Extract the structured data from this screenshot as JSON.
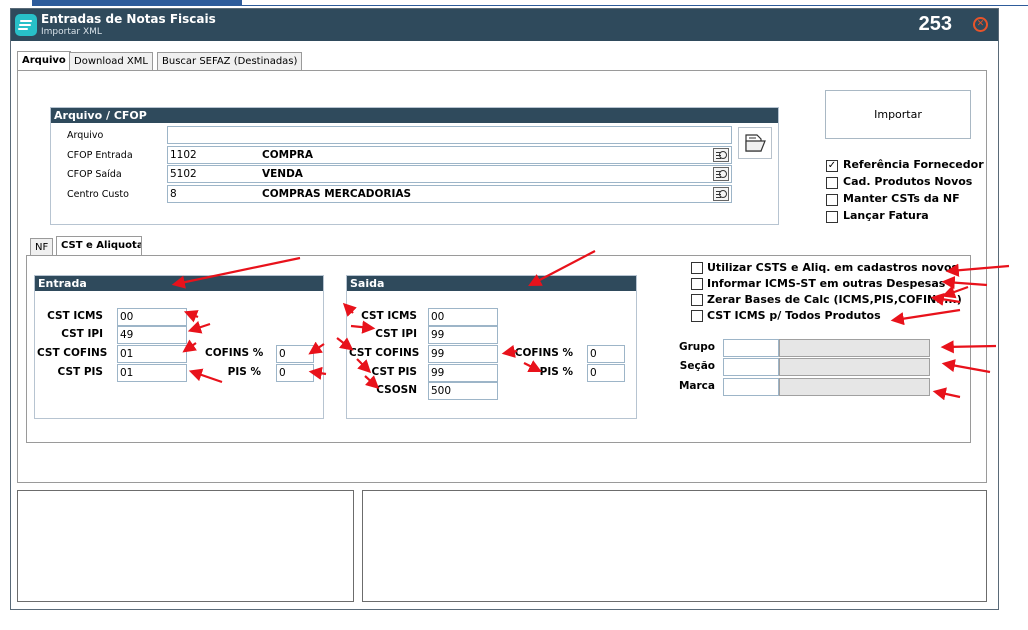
{
  "window": {
    "title": "Entradas de Notas Fiscais",
    "subtitle": "Importar XML",
    "number": "253",
    "close_glyph": "⊗",
    "accent_color": "#2f4a5c",
    "icon_color": "#28c0c8"
  },
  "tabs": [
    {
      "label": "Arquivo",
      "active": true
    },
    {
      "label": "Download XML",
      "active": false
    },
    {
      "label": "Buscar SEFAZ (Destinadas)",
      "active": false
    }
  ],
  "arquivo_cfop": {
    "title": "Arquivo / CFOP",
    "arquivo_label": "Arquivo",
    "arquivo_value": "",
    "rows": [
      {
        "label": "CFOP Entrada",
        "code": "1102",
        "desc": "COMPRA"
      },
      {
        "label": "CFOP Saída",
        "code": "5102",
        "desc": "VENDA"
      },
      {
        "label": "Centro Custo",
        "code": "8",
        "desc": "COMPRAS MERCADORIAS"
      }
    ]
  },
  "import_button": {
    "label": "Importar"
  },
  "options": [
    {
      "label": "Referência Fornecedor",
      "checked": true
    },
    {
      "label": "Cad. Produtos Novos",
      "checked": false
    },
    {
      "label": "Manter CSTs da NF",
      "checked": false
    },
    {
      "label": "Lançar Fatura",
      "checked": false
    }
  ],
  "subtabs": [
    {
      "label": "NF",
      "active": false
    },
    {
      "label": "CST e Aliquota",
      "active": true
    }
  ],
  "entrada": {
    "title": "Entrada",
    "cst_icms_label": "CST ICMS",
    "cst_icms": "00",
    "cst_ipi_label": "CST IPI",
    "cst_ipi": "49",
    "cst_cofins_label": "CST COFINS",
    "cst_cofins": "01",
    "cst_pis_label": "CST PIS",
    "cst_pis": "01",
    "cofins_pct_label": "COFINS %",
    "cofins_pct": "0",
    "pis_pct_label": "PIS %",
    "pis_pct": "0"
  },
  "saida": {
    "title": "Saida",
    "cst_icms_label": "CST ICMS",
    "cst_icms": "00",
    "cst_ipi_label": "CST IPI",
    "cst_ipi": "99",
    "cst_cofins_label": "CST COFINS",
    "cst_cofins": "99",
    "cst_pis_label": "CST PIS",
    "cst_pis": "99",
    "csosn_label": "CSOSN",
    "csosn": "500",
    "cofins_pct_label": "COFINS %",
    "cofins_pct": "0",
    "pis_pct_label": "PIS %",
    "pis_pct": "0"
  },
  "cst_options": [
    {
      "label": "Utilizar CSTS e Aliq. em cadastros novos",
      "checked": false
    },
    {
      "label": "Informar ICMS-ST em outras Despesas",
      "checked": false
    },
    {
      "label": "Zerar Bases de Calc (ICMS,PIS,COFINS...)",
      "checked": false
    },
    {
      "label": "CST ICMS p/ Todos Produtos",
      "checked": false
    }
  ],
  "classification": {
    "grupo_label": "Grupo",
    "grupo_code": "",
    "grupo_desc": "",
    "secao_label": "Seção",
    "secao_code": "",
    "secao_desc": "",
    "marca_label": "Marca",
    "marca_code": "",
    "marca_desc": ""
  },
  "annotation_color": "#e8121b"
}
